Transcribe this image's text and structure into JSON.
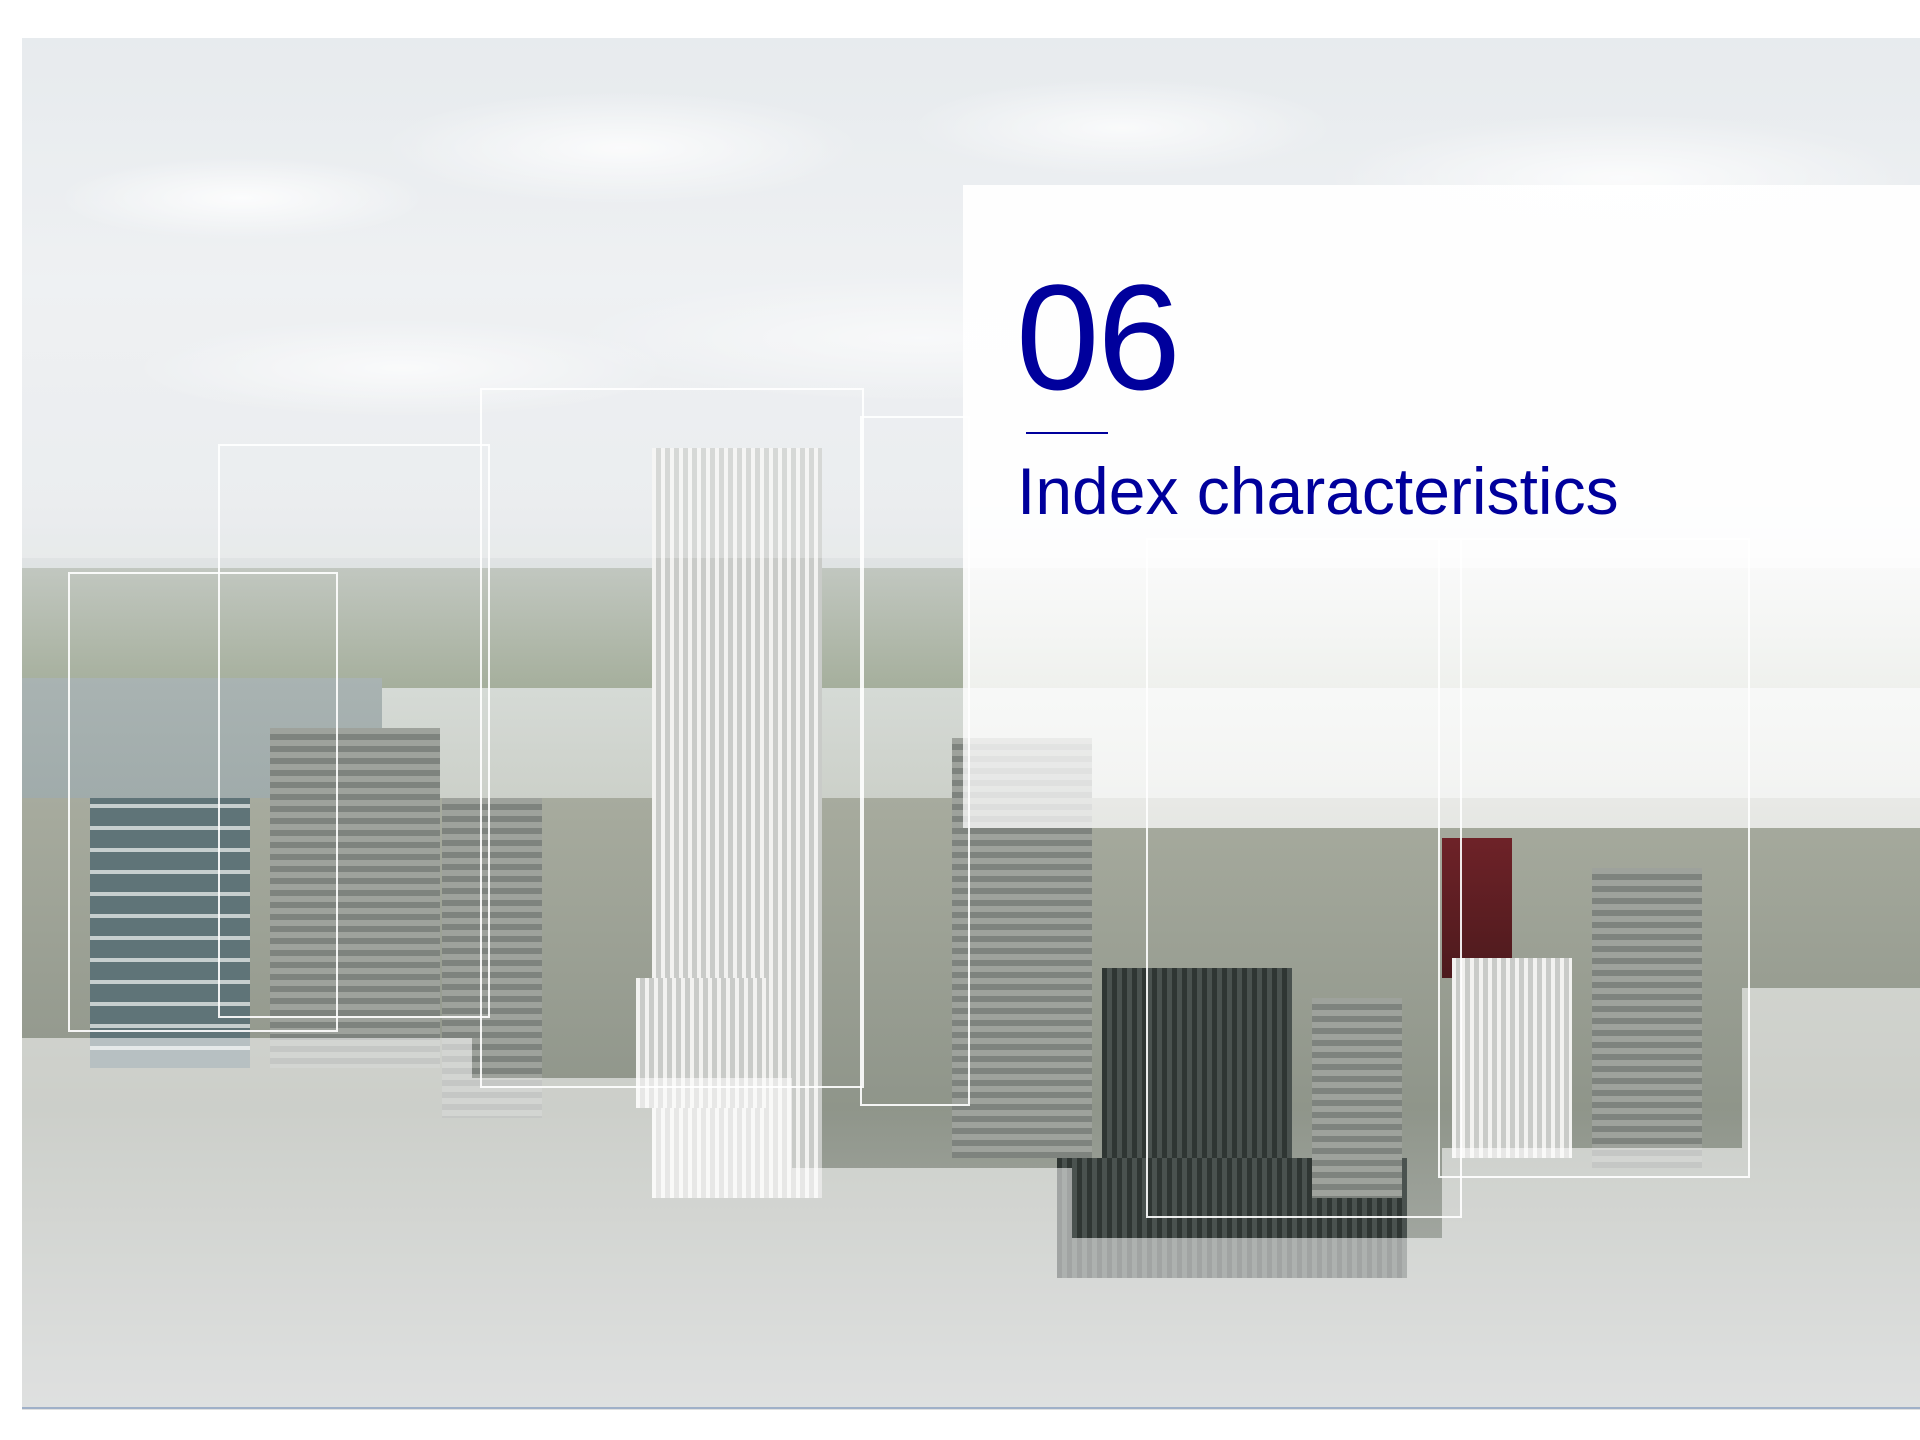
{
  "section": {
    "number": "06",
    "title": "Index characteristics"
  },
  "colors": {
    "accent": "#00009c",
    "panel": "#ffffff"
  },
  "background": {
    "image": "city-skyline-photo"
  }
}
